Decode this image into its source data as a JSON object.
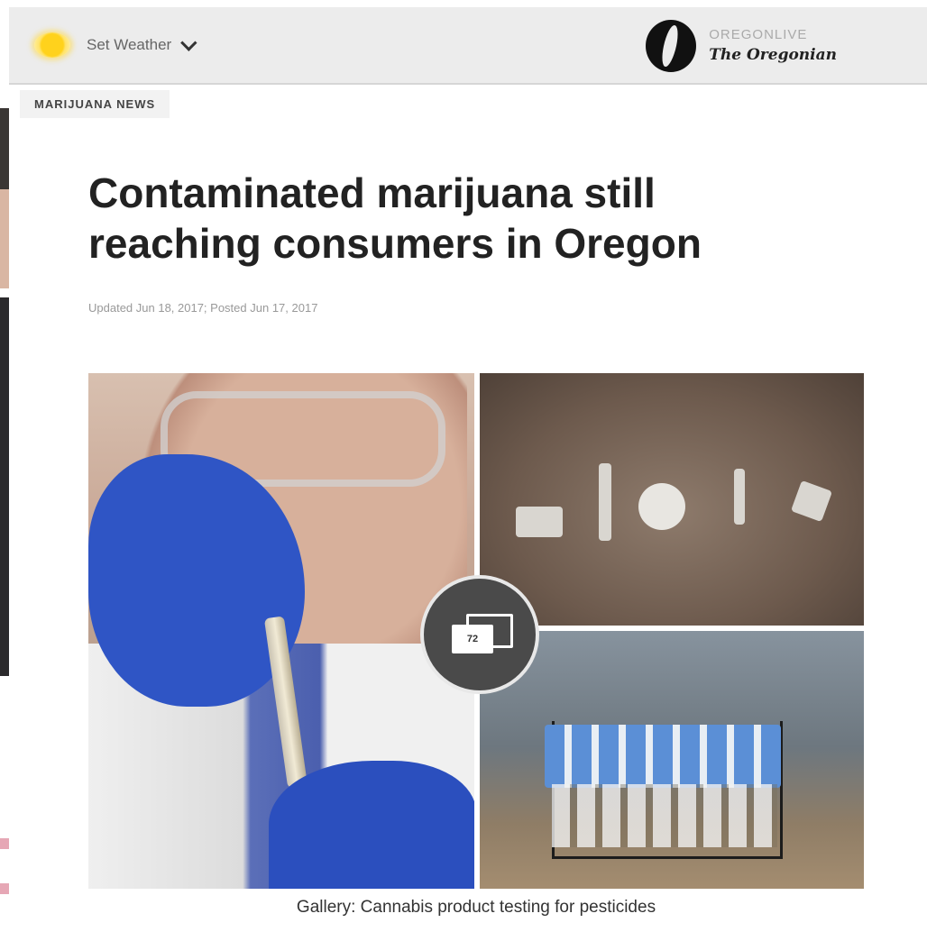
{
  "header": {
    "weather_label": "Set Weather",
    "brand_top": "OREGONLIVE",
    "brand_bottom": "The Oregonian"
  },
  "section": {
    "tag": "MARIJUANA NEWS"
  },
  "article": {
    "headline": "Contaminated marijuana still reaching consumers in Oregon",
    "dateline": "Updated Jun 18, 2017; Posted Jun 17, 2017"
  },
  "gallery": {
    "count": "72",
    "caption": "Gallery: Cannabis product testing for pesticides"
  },
  "colors": {
    "topbar_bg": "#ececec",
    "headline": "#222222",
    "glove_blue": "#2f55c5",
    "sun_yellow": "#ffd21c"
  },
  "icons": [
    "sun-icon",
    "chevron-down-icon",
    "oregonian-logo-icon",
    "gallery-icon"
  ]
}
